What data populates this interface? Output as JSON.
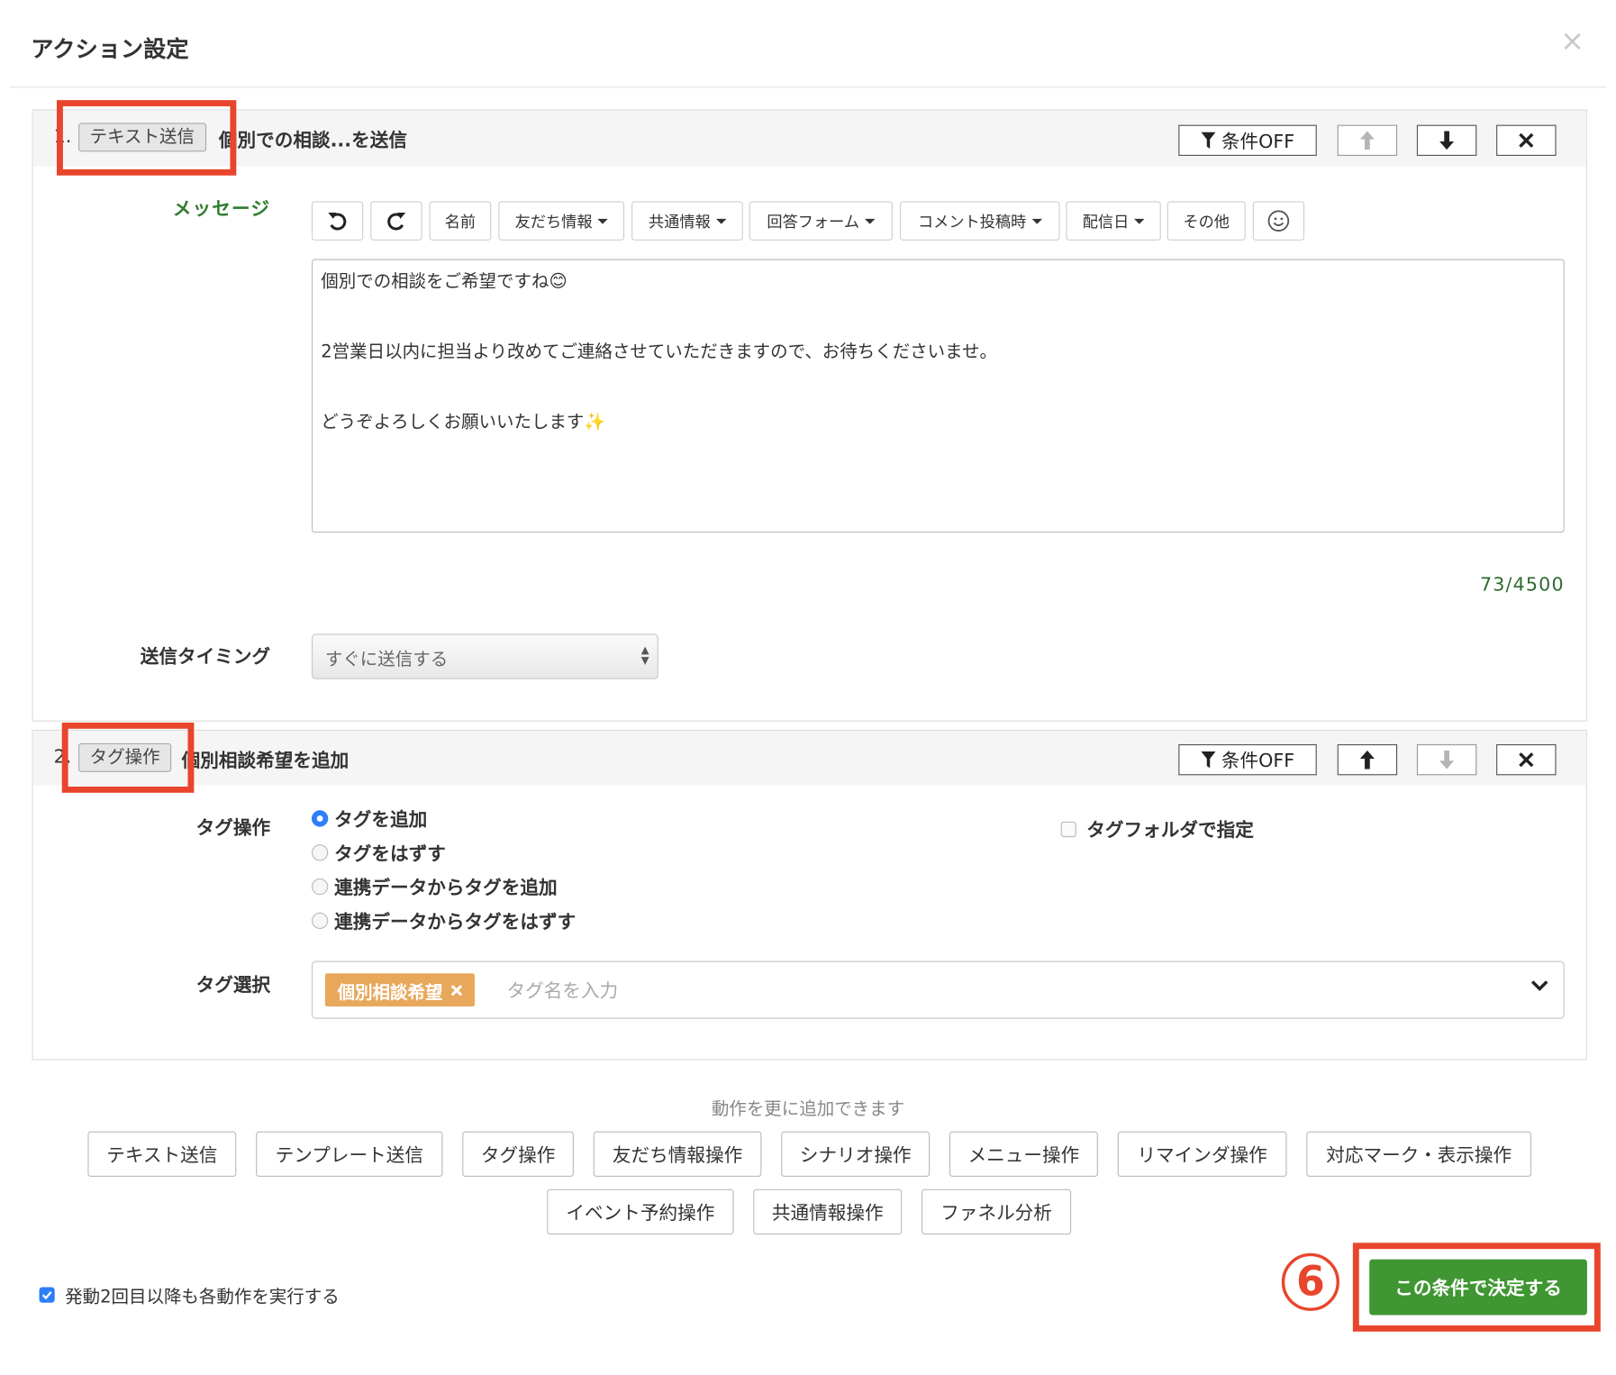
{
  "modal": {
    "title": "アクション設定",
    "close_symbol": "×"
  },
  "actions": [
    {
      "number": "1.",
      "type_badge": "テキスト送信",
      "title": "個別での相談...を送信",
      "cond_label": "条件OFF",
      "message_label": "メッセージ",
      "toolbar": {
        "undo_icon": "undo-icon",
        "redo_icon": "redo-icon",
        "items": [
          "名前",
          "友だち情報",
          "共通情報",
          "回答フォーム",
          "コメント投稿時",
          "配信日",
          "その他"
        ],
        "emoji_icon": "smiley-icon"
      },
      "message_lines": [
        "個別での相談をご希望ですね😊",
        "",
        "2営業日以内に担当より改めてご連絡させていただきますので、お待ちくださいませ。",
        "",
        "どうぞよろしくお願いいたします✨"
      ],
      "char_count": "73/4500",
      "timing_label": "送信タイミング",
      "timing_value": "すぐに送信する"
    },
    {
      "number": "2.",
      "type_badge": "タグ操作",
      "title": "個別相談希望を追加",
      "cond_label": "条件OFF",
      "op_label": "タグ操作",
      "options": [
        "タグを追加",
        "タグをはずす",
        "連携データからタグを追加",
        "連携データからタグをはずす"
      ],
      "selected_option": "タグを追加",
      "folder_label": "タグフォルダで指定",
      "select_label": "タグ選択",
      "selected_tag": "個別相談希望",
      "tag_placeholder": "タグ名を入力"
    }
  ],
  "add_more_hint": "動作を更に追加できます",
  "add_buttons": [
    "テキスト送信",
    "テンプレート送信",
    "タグ操作",
    "友だち情報操作",
    "シナリオ操作",
    "メニュー操作",
    "リマインダ操作",
    "対応マーク・表示操作",
    "イベント予約操作",
    "共通情報操作",
    "ファネル分析"
  ],
  "repeat_checkbox": {
    "label": "発動2回目以降も各動作を実行する",
    "checked": true
  },
  "step_marker": "6",
  "confirm_button": "この条件で決定する",
  "colors": {
    "confirm_green": "#3f9632",
    "annotation_red": "#e8452c",
    "tag_chip": "#e8a85c",
    "radio_blue": "#2d7ff9"
  }
}
